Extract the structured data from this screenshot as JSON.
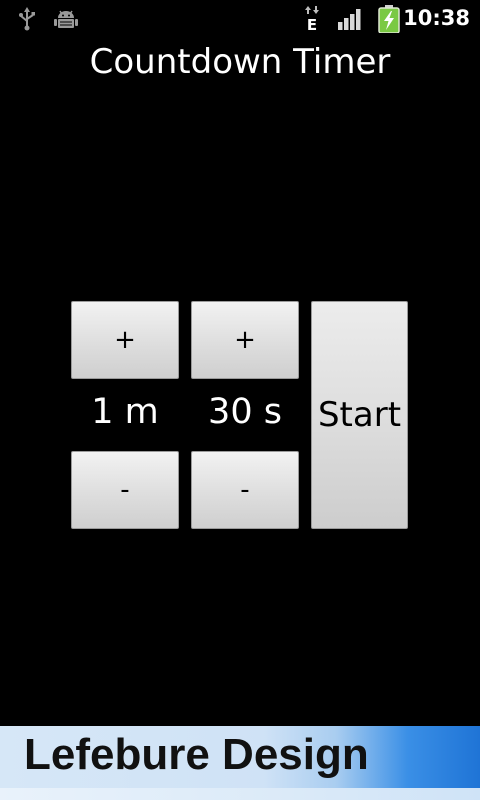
{
  "status_bar": {
    "time": "10:38",
    "network_type": "E",
    "icons": [
      "usb-icon",
      "android-debug-icon",
      "edge-data-icon",
      "signal-icon",
      "battery-charging-icon"
    ],
    "battery_color": "#7ac943"
  },
  "app": {
    "title": "Countdown Timer"
  },
  "timer": {
    "minutes_plus_label": "+",
    "seconds_plus_label": "+",
    "minutes_value": "1 m",
    "seconds_value": "30 s",
    "minutes_minus_label": "-",
    "seconds_minus_label": "-",
    "start_label": "Start"
  },
  "banner": {
    "text": "Lefebure Design",
    "accent_color": "#1f74d6"
  }
}
